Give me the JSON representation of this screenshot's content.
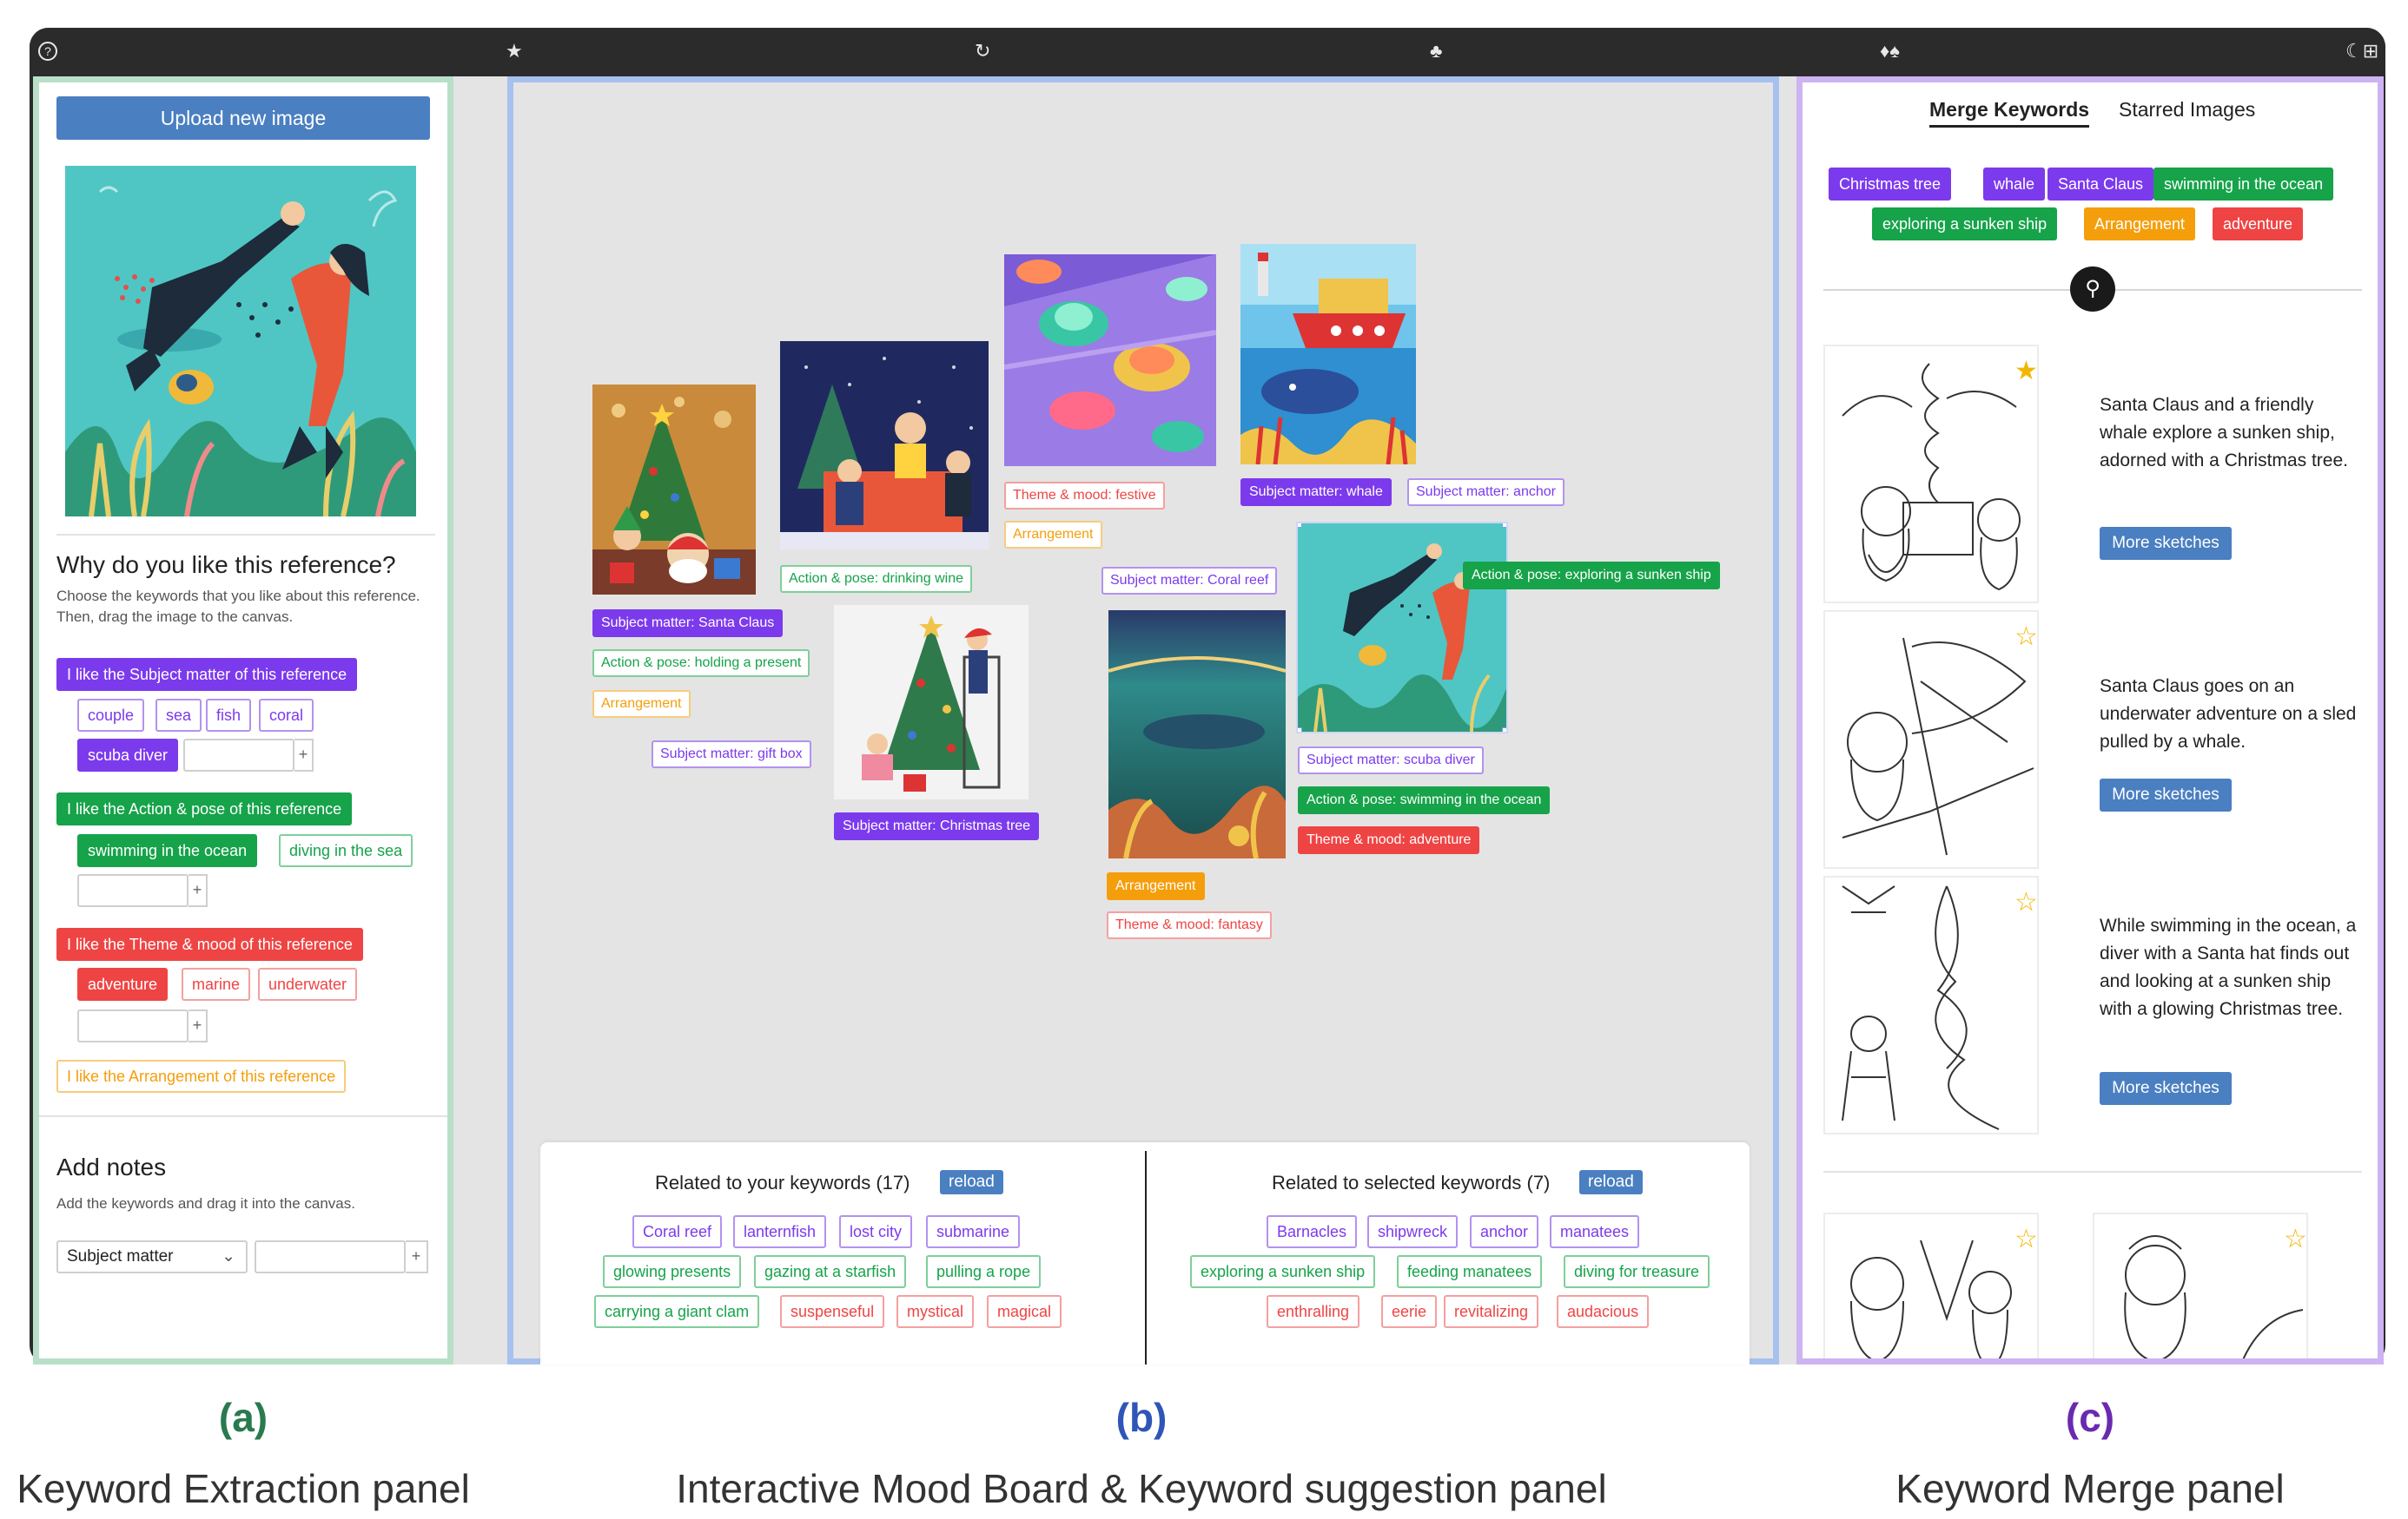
{
  "toolbar": {
    "icons": [
      "help-icon",
      "star-icon",
      "refresh-icon",
      "tree-icon",
      "drops-icon",
      "moon-icon"
    ],
    "help_glyph": "?",
    "star_glyph": "★",
    "refresh_glyph": "↻",
    "tree_glyph": "♣",
    "drops_glyph": "♦♠",
    "moon_glyph": "☾⊞"
  },
  "panel_a": {
    "upload_button": "Upload new image",
    "why_title": "Why do you like this reference?",
    "why_desc_1": "Choose the keywords that you like about this reference.",
    "why_desc_2": "Then, drag the image to the canvas.",
    "subject_header": "I like the Subject matter of this reference",
    "subject_chips": [
      "couple",
      "sea",
      "fish",
      "coral"
    ],
    "subject_selected": "scuba diver",
    "action_header": "I like the Action & pose of this reference",
    "action_selected": "swimming in the ocean",
    "action_chip": "diving in the sea",
    "theme_header": "I like the Theme & mood of this reference",
    "theme_selected": "adventure",
    "theme_chips": [
      "marine",
      "underwater"
    ],
    "arrangement_header": "I like the Arrangement of this reference",
    "plus": "+",
    "notes_title": "Add notes",
    "notes_desc": "Add the keywords and drag it into the canvas.",
    "notes_select": "Subject matter"
  },
  "moodboard": {
    "labels": {
      "santa_subject": "Subject matter: Santa Claus",
      "santa_action": "Action & pose: holding a present",
      "santa_arr": "Arrangement",
      "wine_action": "Action & pose: drinking wine",
      "festive_theme": "Theme & mood: festive",
      "festive_arr": "Arrangement",
      "whale_subject": "Subject matter: whale",
      "anchor_subject": "Subject matter: anchor",
      "giftbox_subject": "Subject matter: gift box",
      "tree_subject": "Subject matter: Christmas tree",
      "coral_subject": "Subject matter: Coral reef",
      "explore_action": "Action & pose: exploring a sunken ship",
      "scuba_subject": "Subject matter: scuba diver",
      "swim_action": "Action & pose: swimming in the ocean",
      "adventure_theme": "Theme & mood: adventure",
      "ocean_arr": "Arrangement",
      "fantasy_theme": "Theme & mood: fantasy"
    }
  },
  "suggestions": {
    "left_title": "Related to your keywords (17)",
    "right_title": "Related to selected keywords (7)",
    "reload": "reload",
    "left_purple": [
      "Coral reef",
      "lanternfish",
      "lost city",
      "submarine"
    ],
    "left_green_1": [
      "glowing presents",
      "gazing at a starfish",
      "pulling a rope"
    ],
    "left_green_2": "carrying a giant clam",
    "left_red": [
      "suspenseful",
      "mystical",
      "magical"
    ],
    "right_purple": [
      "Barnacles",
      "shipwreck",
      "anchor",
      "manatees"
    ],
    "right_green": [
      "exploring a sunken ship",
      "feeding manatees",
      "diving for treasure"
    ],
    "right_red": [
      "enthralling",
      "eerie",
      "revitalizing",
      "audacious"
    ]
  },
  "panel_c": {
    "tab_merge": "Merge Keywords",
    "tab_starred": "Starred Images",
    "merge_chips_row1": [
      "Christmas tree",
      "whale",
      "Santa Claus",
      "swimming in the ocean"
    ],
    "merge_chips_row2": [
      "exploring a sunken ship",
      "Arrangement",
      "adventure"
    ],
    "merge_icon": "merge-icon",
    "sketches": [
      {
        "text": "Santa Claus and a friendly whale explore a sunken ship, adorned with a Christmas tree.",
        "button": "More sketches",
        "starred": true
      },
      {
        "text": "Santa Claus goes on an underwater adventure on a sled pulled by a whale.",
        "button": "More sketches",
        "starred": false
      },
      {
        "text": "While swimming in the ocean, a diver with a Santa hat finds out and looking at a sunken ship with a glowing Christmas tree.",
        "button": "More sketches",
        "starred": false
      }
    ],
    "star_filled": "★",
    "star_empty": "☆"
  },
  "captions": {
    "a_letter": "(a)",
    "a_text": "Keyword Extraction panel",
    "b_letter": "(b)",
    "b_text": "Interactive Mood Board & Keyword suggestion panel",
    "c_letter": "(c)",
    "c_text": "Keyword Merge panel"
  },
  "colors": {
    "subject": "#7c3aed",
    "action": "#16a34a",
    "theme": "#ef4444",
    "arrangement": "#f59e0b",
    "accent_blue": "#4a7fc1",
    "caption_a": "#2a7a4f",
    "caption_b": "#2f55b8",
    "caption_c": "#6a2ab0"
  }
}
